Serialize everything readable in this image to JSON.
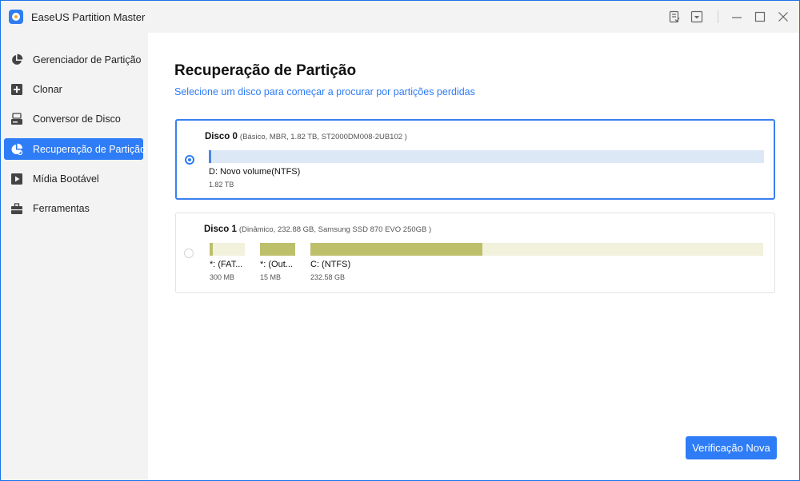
{
  "window": {
    "title": "EaseUS Partition Master",
    "accent": "#2e7cf6"
  },
  "titlebar_icons": [
    "feedback-icon",
    "dropdown-menu-icon",
    "minimize-icon",
    "maximize-icon",
    "close-icon"
  ],
  "sidebar": {
    "items": [
      {
        "label": "Gerenciador de Partição",
        "icon": "pie-chart-icon",
        "active": false
      },
      {
        "label": "Clonar",
        "icon": "clone-icon",
        "active": false
      },
      {
        "label": "Conversor de Disco",
        "icon": "disk-converter-icon",
        "active": false
      },
      {
        "label": "Recuperação de Partição",
        "icon": "partition-recovery-icon",
        "active": true
      },
      {
        "label": "Mídia Bootável",
        "icon": "bootable-media-icon",
        "active": false
      },
      {
        "label": "Ferramentas",
        "icon": "toolbox-icon",
        "active": false
      }
    ]
  },
  "main": {
    "title": "Recuperação de Partição",
    "subtitle": "Selecione um disco para começar a procurar por partições perdidas",
    "disks": [
      {
        "name": "Disco 0",
        "info": "(Básico, MBR, 1.82 TB, ST2000DM008-2UB102 )",
        "selected": true,
        "partitions": [
          {
            "name": "D: Novo volume(NTFS)",
            "size": "1.82 TB",
            "used_fraction": 0.003,
            "fill_color": "#4a86e8",
            "track_color": "#dde8f7"
          }
        ]
      },
      {
        "name": "Disco 1",
        "info": "(Dinâmico, 232.88 GB, Samsung SSD 870 EVO 250GB )",
        "selected": false,
        "partitions": [
          {
            "name": "*: (FAT...",
            "size": "300 MB",
            "used_fraction": 0.1,
            "fill_color": "#bdbf6b",
            "track_color": "#f1f1dc"
          },
          {
            "name": "*: (Out...",
            "size": "15 MB",
            "used_fraction": 1.0,
            "fill_color": "#bdbf6b",
            "track_color": "#f1f1dc"
          },
          {
            "name": "C: (NTFS)",
            "size": "232.58 GB",
            "used_fraction": 0.38,
            "fill_color": "#bdbf6b",
            "track_color": "#f1f1dc"
          }
        ]
      }
    ],
    "scan_button_label": "Verificação Nova"
  }
}
